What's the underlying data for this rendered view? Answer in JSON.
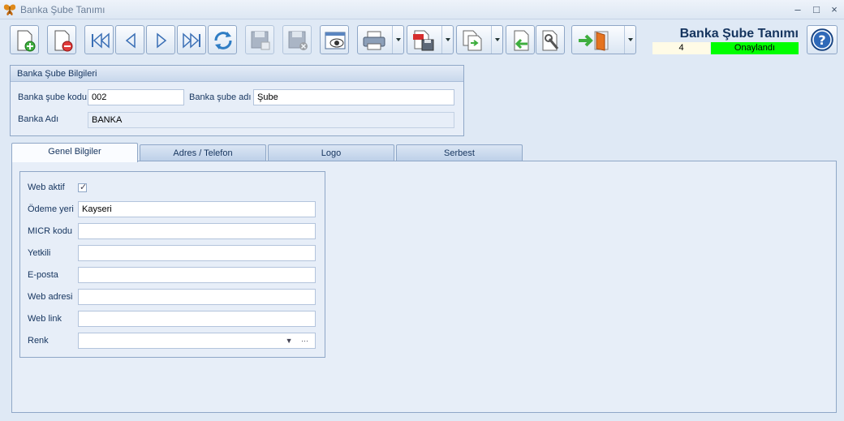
{
  "window": {
    "title": "Banka Şube Tanımı",
    "controls": [
      "–",
      "□",
      "×"
    ]
  },
  "header": {
    "form_title": "Banka Şube Tanımı",
    "record_count": "4",
    "status": "Onaylandı",
    "status_color": "#00ff00"
  },
  "group": {
    "title": "Banka Şube Bilgileri",
    "branch_code_label": "Banka şube kodu",
    "branch_code_value": "002",
    "branch_name_label": "Banka şube adı",
    "branch_name_value": "Şube",
    "bank_name_label": "Banka Adı",
    "bank_name_value": "BANKA"
  },
  "tabs": [
    "Genel Bilgiler",
    "Adres / Telefon",
    "Logo",
    "Serbest"
  ],
  "general": {
    "web_active_label": "Web aktif",
    "web_active_checked": true,
    "payment_place_label": "Ödeme yeri",
    "payment_place_value": "Kayseri",
    "micr_label": "MICR kodu",
    "micr_value": "",
    "authorized_label": "Yetkili",
    "authorized_value": "",
    "email_label": "E-posta",
    "email_value": "",
    "web_address_label": "Web adresi",
    "web_address_value": "",
    "web_link_label": "Web link",
    "web_link_value": "",
    "color_label": "Renk",
    "color_value": ""
  },
  "toolbar": {
    "icons": [
      "new-document-icon",
      "delete-document-icon",
      "first-record-icon",
      "previous-record-icon",
      "next-record-icon",
      "last-record-icon",
      "refresh-icon",
      "save-icon",
      "cancel-save-icon",
      "preview-icon",
      "print-icon",
      "pdf-export-icon",
      "copy-icon",
      "import-icon",
      "tools-icon",
      "exit-icon",
      "help-icon"
    ]
  }
}
